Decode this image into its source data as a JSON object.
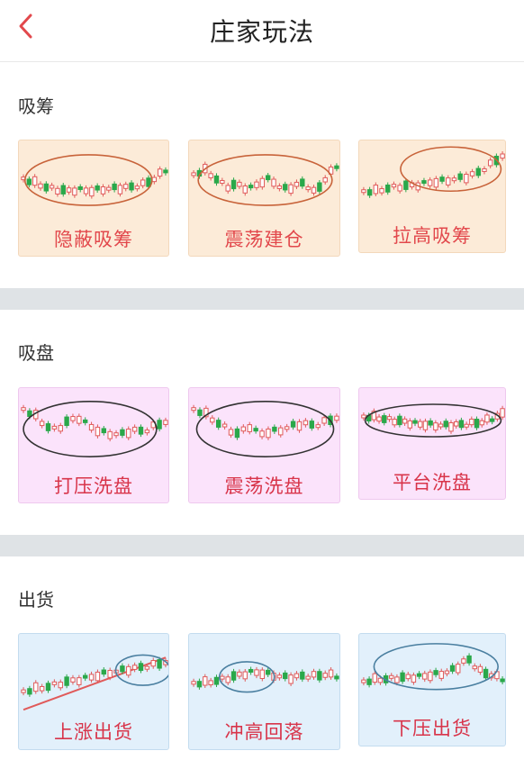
{
  "header": {
    "title": "庄家玩法",
    "back_icon": "chevron-left-icon"
  },
  "colors": {
    "accent": "#e2484c",
    "section1_bg": "#fcebd8",
    "section1_border": "#f3d8bb",
    "section1_label": "#e2484c",
    "section2_bg": "#fbe3fb",
    "section2_border": "#eec8ee",
    "section2_label": "#d8344a",
    "section3_bg": "#e2f0fb",
    "section3_border": "#c3dcef",
    "section3_label": "#d8344a",
    "candle_up": "#e05a5a",
    "candle_down": "#2aa84a",
    "ellipse_orange": "#c8633a",
    "ellipse_dark": "#333333",
    "ellipse_blue": "#4a7fa0"
  },
  "sections": [
    {
      "title": "吸筹",
      "cards": [
        {
          "label": "隐蔽吸筹"
        },
        {
          "label": "震荡建仓"
        },
        {
          "label": "拉高吸筹"
        }
      ]
    },
    {
      "title": "吸盘",
      "cards": [
        {
          "label": "打压洗盘"
        },
        {
          "label": "震荡洗盘"
        },
        {
          "label": "平台洗盘"
        }
      ]
    },
    {
      "title": "出货",
      "cards": [
        {
          "label": "上涨出货"
        },
        {
          "label": "冲高回落"
        },
        {
          "label": "下压出货"
        }
      ]
    }
  ]
}
